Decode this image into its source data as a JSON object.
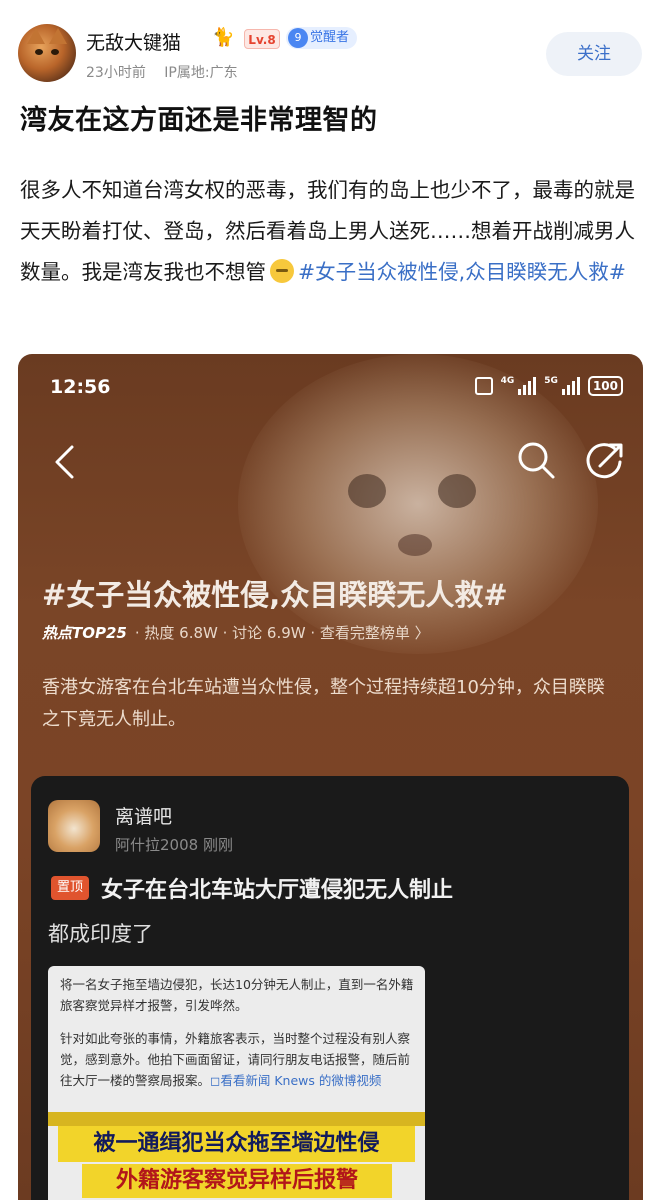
{
  "post": {
    "author": {
      "name": "无敌大键猫",
      "name_emoji": "🐈",
      "level": "Lv.8",
      "badge_number": "9",
      "badge_label": "觉醒者"
    },
    "meta": {
      "time": "23小时前",
      "location": "IP属地:广东"
    },
    "follow_label": "关注",
    "title": "湾友在这方面还是非常理智的",
    "body_text": "很多人不知道台湾女权的恶毒，我们有的岛上也少不了，最毒的就是天天盼着打仗、登岛，然后看着岛上男人送死……想着开战削减男人数量。我是湾友我也不想管",
    "hashtag": "#女子当众被性侵,众目睽睽无人救#"
  },
  "screenshot": {
    "status_bar": {
      "time": "12:56",
      "net1": "4G",
      "net2": "5G",
      "battery": "100"
    },
    "topic": {
      "title": "#女子当众被性侵,众目睽睽无人救#",
      "rank": "热点TOP25",
      "stats": "· 热度 6.8W · 讨论 6.9W · 查看完整榜单 〉",
      "description": "香港女游客在台北车站遭当众性侵，整个过程持续超10分钟，众目睽睽之下竟无人制止。"
    },
    "card": {
      "name": "离谱吧",
      "meta": "阿什拉2008 刚刚",
      "pin_label": "置顶",
      "title": "女子在台北车站大厅遭侵犯无人制止",
      "subtitle": "都成印度了",
      "news_p1": "将一名女子拖至墙边侵犯，长达10分钟无人制止，直到一名外籍旅客察觉异样才报警，引发哗然。",
      "news_p2": "针对如此夸张的事情，外籍旅客表示，当时整个过程没有别人察觉，感到意外。他拍下画面留证，请同行朋友电话报警，随后前往大厅一楼的警察局报案。",
      "news_link": "◻看看新闻 Knews 的微博视频",
      "banner_line2": "被一通缉犯当众拖至墙边性侵",
      "banner_line3": "外籍游客察觉异样后报警"
    }
  }
}
